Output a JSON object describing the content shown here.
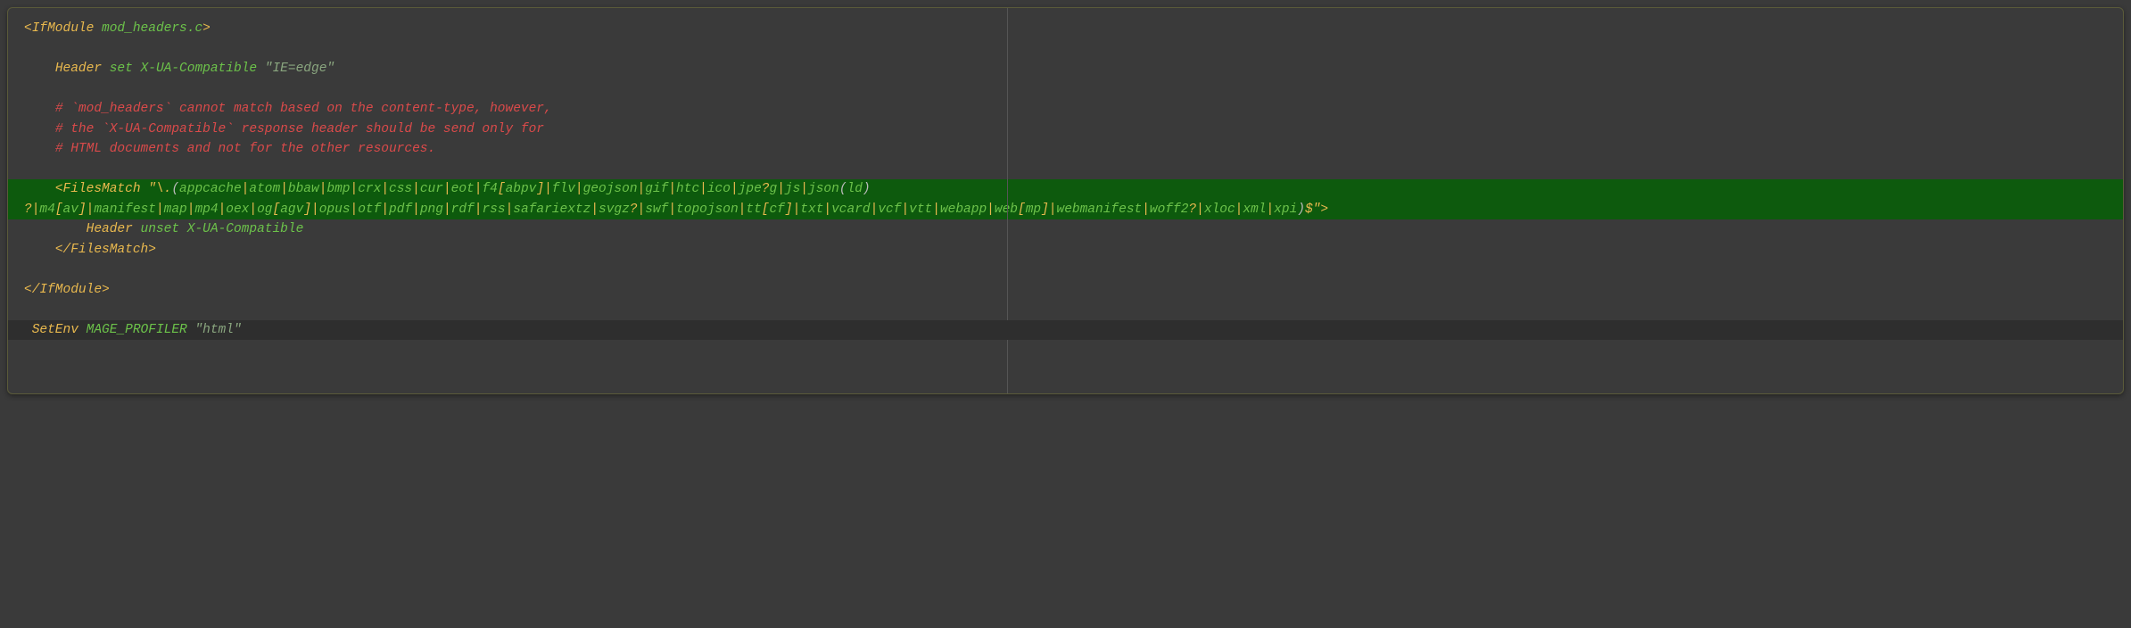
{
  "code": {
    "line1_open": "<",
    "line1_tag": "IfModule",
    "line1_sp": " ",
    "line1_attr": "mod_headers.c",
    "line1_close": ">",
    "line3_ind": "    ",
    "line3_kw": "Header",
    "line3_sp1": " ",
    "line3_set": "set",
    "line3_sp2": " ",
    "line3_hdr": "X-UA-Compatible",
    "line3_sp3": " ",
    "line3_val": "\"IE=edge\"",
    "line5_ind": "    ",
    "line5_txt": "# `mod_headers` cannot match based on the content-type, however,",
    "line6_ind": "    ",
    "line6_txt": "# the `X-UA-Compatible` response header should be send only for",
    "line7_ind": "    ",
    "line7_txt": "# HTML documents and not for the other resources.",
    "line9_ind": "    ",
    "line9_open": "<",
    "line9_tag": "FilesMatch",
    "line9_sp": " ",
    "line9_q": "\"",
    "line9_esc": "\\.",
    "line9_lp": "(",
    "regex1": [
      "appcache",
      "atom",
      "bbaw",
      "bmp",
      "crx",
      "css",
      "cur",
      "eot",
      "f4[abpv]",
      "flv",
      "geojson",
      "gif",
      "htc",
      "ico",
      "jpe?g",
      "js",
      "json"
    ],
    "line9_rp": "(",
    "line9_ld": "ld",
    "line9_rp2": ")",
    "line10_q": "?",
    "regex2": [
      "m4[av]",
      "manifest",
      "map",
      "mp4",
      "oex",
      "og[agv]",
      "opus",
      "otf",
      "pdf",
      "png",
      "rdf",
      "rss",
      "safariextz",
      "svgz?",
      "swf",
      "topojson",
      "tt[cf]",
      "txt",
      "vcard",
      "vcf",
      "vtt",
      "webapp",
      "web[mp]",
      "webmanifest",
      "woff2?",
      "xloc",
      "xml",
      "xpi"
    ],
    "line10_rp": ")",
    "line10_dollar": "$",
    "line10_q2": "\"",
    "line10_close": ">",
    "line11_ind": "        ",
    "line11_kw": "Header",
    "line11_sp1": " ",
    "line11_unset": "unset",
    "line11_sp2": " ",
    "line11_hdr": "X-UA-Compatible",
    "line12_ind": "    ",
    "line12_open": "</",
    "line12_tag": "FilesMatch",
    "line12_close": ">",
    "line14_open": "</",
    "line14_tag": "IfModule",
    "line14_close": ">",
    "line16_ind": " ",
    "line16_kw": "SetEnv",
    "line16_sp": " ",
    "line16_var": "MAGE_PROFILER",
    "line16_sp2": " ",
    "line16_val": "\"html\""
  }
}
